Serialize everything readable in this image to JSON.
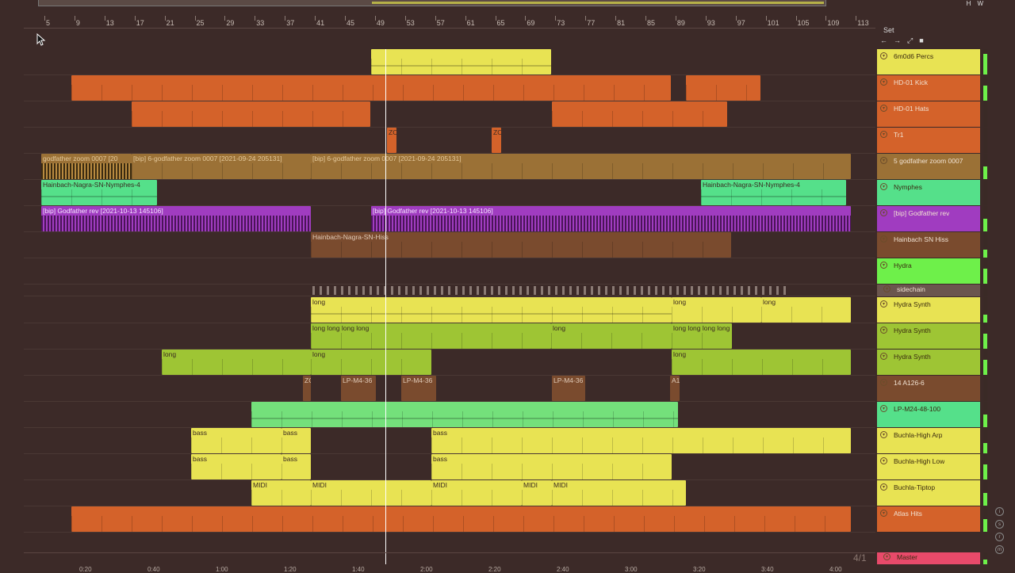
{
  "overview": {
    "topbar_buttons": [
      "H",
      "W"
    ]
  },
  "ruler": {
    "bars": [
      "5",
      "9",
      "13",
      "17",
      "21",
      "25",
      "29",
      "33",
      "37",
      "41",
      "45",
      "49",
      "53",
      "57",
      "61",
      "65",
      "69",
      "73",
      "77",
      "81",
      "85",
      "89",
      "93",
      "97",
      "101",
      "105",
      "109",
      "113"
    ]
  },
  "set": {
    "label": "Set",
    "controls": [
      "←",
      "→",
      "⤢",
      "🔒"
    ]
  },
  "timeline": {
    "times": [
      "0:20",
      "0:40",
      "1:00",
      "1:20",
      "1:40",
      "2:00",
      "2:20",
      "2:40",
      "3:00",
      "3:20",
      "3:40",
      "4:00"
    ]
  },
  "master_time_sig": "4/1",
  "tracks": [
    {
      "name": "6m0d6 Percs",
      "color": "#e8e353"
    },
    {
      "name": "HD-01 Kick",
      "color": "#d4622a"
    },
    {
      "name": "HD-01 Hats",
      "color": "#d4622a"
    },
    {
      "name": "Tr1",
      "color": "#d4622a"
    },
    {
      "name": "5 godfather zoom 0007",
      "color": "#9b7136"
    },
    {
      "name": "Nymphes",
      "color": "#55e08a"
    },
    {
      "name": "[bip] Godfather rev",
      "color": "#a03cc0"
    },
    {
      "name": "Hainbach SN Hiss",
      "color": "#7a4b2e"
    },
    {
      "name": "Hydra",
      "color": "#6ef04a"
    },
    {
      "name": "sidechain",
      "color": "#6b564e"
    },
    {
      "name": "Hydra Synth",
      "color": "#e8e353"
    },
    {
      "name": "Hydra Synth",
      "color": "#9ec534"
    },
    {
      "name": "Hydra Synth",
      "color": "#9ec534"
    },
    {
      "name": "14 A126-6",
      "color": "#7a4b2e"
    },
    {
      "name": "LP-M24-48-100",
      "color": "#55e08a"
    },
    {
      "name": "Buchla-High Arp",
      "color": "#e8e353"
    },
    {
      "name": "Buchla-High Low",
      "color": "#e8e353"
    },
    {
      "name": "Buchla-Tiptop",
      "color": "#e8e353"
    },
    {
      "name": "Atlas Hits",
      "color": "#d4622a"
    },
    {
      "name": "Master",
      "color": "#e84a6a"
    }
  ],
  "clips": {
    "godfather_1": "godfather zoom 0007 [20",
    "godfather_2": "[bip] 6-godfather zoom 0007 [2021-09-24 205131]",
    "godfather_3": "[bip] 6-godfather zoom 0007 [2021-09-24 205131]",
    "nymphes_1": "Hainbach-Nagra-SN-Nymphes-4",
    "nymphes_2": "Hainbach-Nagra-SN-Nymphes-4",
    "bip_1": "[bip] Godfather rev [2021-10-13 145106]",
    "bip_2": "[bip] Godfather rev [2021-10-13 145106]",
    "hiss_1": "Hainbach-Nagra-SN-Hiss",
    "long": "long",
    "longs": "long long long long",
    "bass": "bass",
    "midi": "MIDI",
    "lp1": "LP-M4-36",
    "lp2": "LP-M4-36",
    "lp3": "LP-M4-36",
    "a1": "A1",
    "zo": "ZO"
  }
}
